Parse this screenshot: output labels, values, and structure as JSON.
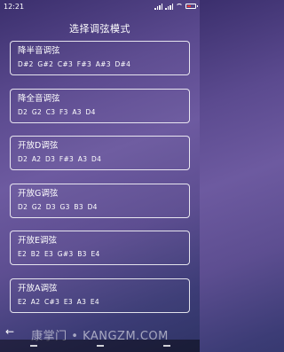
{
  "status_bar": {
    "time": "12:21"
  },
  "page": {
    "title": "选择调弦模式"
  },
  "tunings": [
    {
      "name": "降半音调弦",
      "notes": "D#2 G#2 C#3 F#3 A#3 D#4"
    },
    {
      "name": "降全音调弦",
      "notes": "D2 G2 C3 F3 A3 D4"
    },
    {
      "name": "开放D调弦",
      "notes": "D2 A2 D3 F#3 A3 D4"
    },
    {
      "name": "开放G调弦",
      "notes": "D2 G2 D3 G3 B3 D4"
    },
    {
      "name": "开放E调弦",
      "notes": "E2 B2 E3 G#3 B3 E4"
    },
    {
      "name": "开放A调弦",
      "notes": "E2 A2 C#3 E3 A3 E4"
    }
  ],
  "watermark": "康掌门 • KANGZM.COM",
  "icons": {
    "back": "back-arrow-icon"
  }
}
